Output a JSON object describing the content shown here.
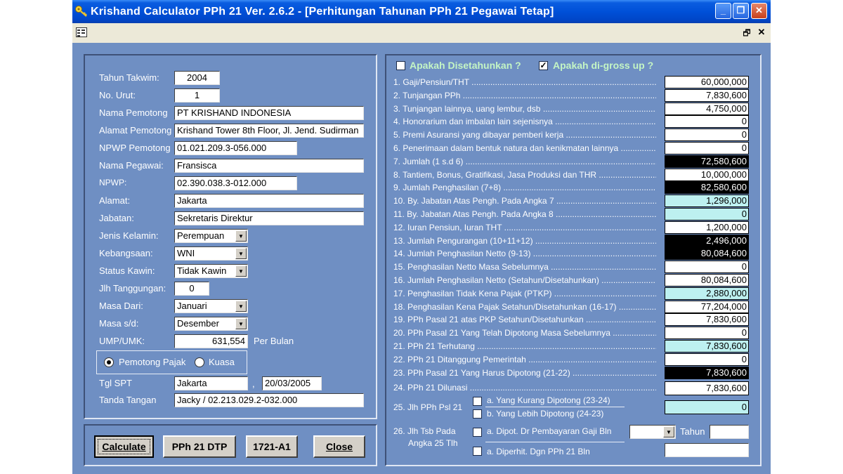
{
  "window": {
    "title": "Krishand Calculator PPh 21 Ver. 2.6.2 - [Perhitungan Tahunan PPh 21 Pegawai Tetap]",
    "minimize_glyph": "_",
    "restore_glyph": "❐",
    "close_glyph": "✕",
    "icon": "key-icon",
    "menu_icon": "form-icon",
    "mdi_restore_glyph": "🗗",
    "mdi_close_glyph": "✕"
  },
  "left_form": {
    "tahun_takwim": {
      "label": "Tahun Takwim:",
      "value": "2004"
    },
    "no_urut": {
      "label": "No. Urut:",
      "value": "1"
    },
    "nama_pemotong": {
      "label": "Nama Pemotong",
      "value": "PT KRISHAND INDONESIA"
    },
    "alamat_pemotong": {
      "label": "Alamat Pemotong",
      "value": "Krishand Tower 8th Floor, Jl. Jend. Sudirman"
    },
    "npwp_pemotong": {
      "label": "NPWP Pemotong",
      "value": "01.021.209.3-056.000"
    },
    "nama_pegawai": {
      "label": "Nama Pegawai:",
      "value": "Fransisca"
    },
    "npwp": {
      "label": "NPWP:",
      "value": "02.390.038.3-012.000"
    },
    "alamat": {
      "label": "Alamat:",
      "value": "Jakarta"
    },
    "jabatan": {
      "label": "Jabatan:",
      "value": "Sekretaris Direktur"
    },
    "jenis_kelamin": {
      "label": "Jenis Kelamin:",
      "value": "Perempuan"
    },
    "kebangsaan": {
      "label": "Kebangsaan:",
      "value": "WNI"
    },
    "status_kawin": {
      "label": "Status Kawin:",
      "value": "Tidak Kawin"
    },
    "jlh_tanggungan": {
      "label": "Jlh Tanggungan:",
      "value": "0"
    },
    "masa_dari": {
      "label": "Masa Dari:",
      "value": "Januari"
    },
    "masa_sd": {
      "label": "Masa s/d:",
      "value": "Desember"
    },
    "ump": {
      "label": "UMP/UMK:",
      "value": "631,554",
      "unit": "Per Bulan"
    },
    "radio_pemotong": "Pemotong Pajak",
    "radio_kuasa": "Kuasa",
    "tgl_spt": {
      "label": "Tgl SPT",
      "place": "Jakarta",
      "sep": ",",
      "date": "20/03/2005"
    },
    "tanda_tangan": {
      "label": "Tanda Tangan",
      "value": "Jacky / 02.213.029.2-032.000"
    }
  },
  "buttons": {
    "calculate": "Calculate",
    "pph21dtp": "PPh 21 DTP",
    "a1": "1721-A1",
    "close": "Close"
  },
  "right": {
    "disetahunkan": {
      "label": "Apakah Disetahunkan ?",
      "checked": false
    },
    "grossup": {
      "label": "Apakah di-gross up ?",
      "checked": true
    },
    "rows": [
      {
        "label": "1. Gaji/Pensiun/THT .......................................................................................",
        "value": "60,000,000",
        "style": "white"
      },
      {
        "label": "2. Tunjangan PPh ...........................................................................................",
        "value": "7,830,600",
        "style": "white"
      },
      {
        "label": "3. Tunjangan lainnya, uang lembur, dsb .......................................................",
        "value": "4,750,000",
        "style": "white"
      },
      {
        "label": "4. Honorarium dan imbalan lain sejenisnya ...................................................",
        "value": "0",
        "style": "white"
      },
      {
        "label": "5. Premi Asuransi yang dibayar pemberi kerja ................................................",
        "value": "0",
        "style": "white"
      },
      {
        "label": "6. Penerimaan dalam bentuk natura dan kenikmatan lainnya ..........................",
        "value": "0",
        "style": "white"
      },
      {
        "label": "7. Jumlah (1 s.d 6) ..........................................................................................",
        "value": "72,580,600",
        "style": "black"
      },
      {
        "label": "8. Tantiem, Bonus, Gratifikasi, Jasa Produksi dan THR ...................................",
        "value": "10,000,000",
        "style": "white"
      },
      {
        "label": "9. Jumlah Penghasilan (7+8) ..........................................................................",
        "value": "82,580,600",
        "style": "black"
      },
      {
        "label": "10. By. Jabatan Atas Pengh. Pada Angka 7 ...................................................",
        "value": "1,296,000",
        "style": "cyan"
      },
      {
        "label": "11. By. Jabatan Atas Pengh. Pada Angka 8 ...................................................",
        "value": "0",
        "style": "cyan"
      },
      {
        "label": "12. Iuran Pensiun, Iuran THT .........................................................................",
        "value": "1,200,000",
        "style": "white"
      },
      {
        "label": "13. Jumlah Pengurangan (10+11+12) ...........................................................",
        "value": "2,496,000",
        "style": "black"
      },
      {
        "label": "14. Jumlah Penghasilan Netto (9-13) ............................................................",
        "value": "80,084,600",
        "style": "black"
      },
      {
        "label": "15. Penghasilan Netto Masa Sebelumnya ......................................................",
        "value": "0",
        "style": "white"
      },
      {
        "label": "16. Jumlah Penghasilan Netto (Setahun/Disetahunkan) ..................................",
        "value": "80,084,600",
        "style": "white"
      },
      {
        "label": "17. Penghasilan Tidak Kena Pajak (PTKP) ...................................................",
        "value": "2,880,000",
        "style": "cyan"
      },
      {
        "label": "18. Penghasilan Kena Pajak Setahun/Disetahunkan (16-17) ............................",
        "value": "77,204,000",
        "style": "white"
      },
      {
        "label": "19. PPh Pasal 21 atas PKP Setahun/Disetahunkan .........................................",
        "value": "7,830,600",
        "style": "white"
      },
      {
        "label": "20. PPh Pasal 21 Yang Telah Dipotong Masa Sebelumnya ..............................",
        "value": "0",
        "style": "white"
      },
      {
        "label": "21. PPh 21 Terhutang .......................................................................................",
        "value": "7,830,600",
        "style": "cyan"
      },
      {
        "label": "22. PPh 21 Ditanggung Pemerintah ..............................................................",
        "value": "0",
        "style": "white"
      },
      {
        "label": "23. PPh Pasal 21 Yang Harus Dipotong (21-22) ............................................",
        "value": "7,830,600",
        "style": "black"
      },
      {
        "label": "24. PPh 21 Dilunasi ........................................................................................",
        "value": "7,830,600",
        "style": "white"
      }
    ],
    "row25": {
      "label": "25. Jlh PPh Psl 21",
      "a": "a. Yang Kurang Dipotong (23-24)",
      "b": "b. Yang Lebih Dipotong (24-23)",
      "value": "0"
    },
    "row26": {
      "label1": "26. Jlh Tsb Pada",
      "label2": "Angka 25 Tlh",
      "a": "a. Dipot. Dr Pembayaran Gaji Bln",
      "tahun": "Tahun",
      "b": "a. Diperhit. Dgn PPh 21 Bln"
    }
  }
}
